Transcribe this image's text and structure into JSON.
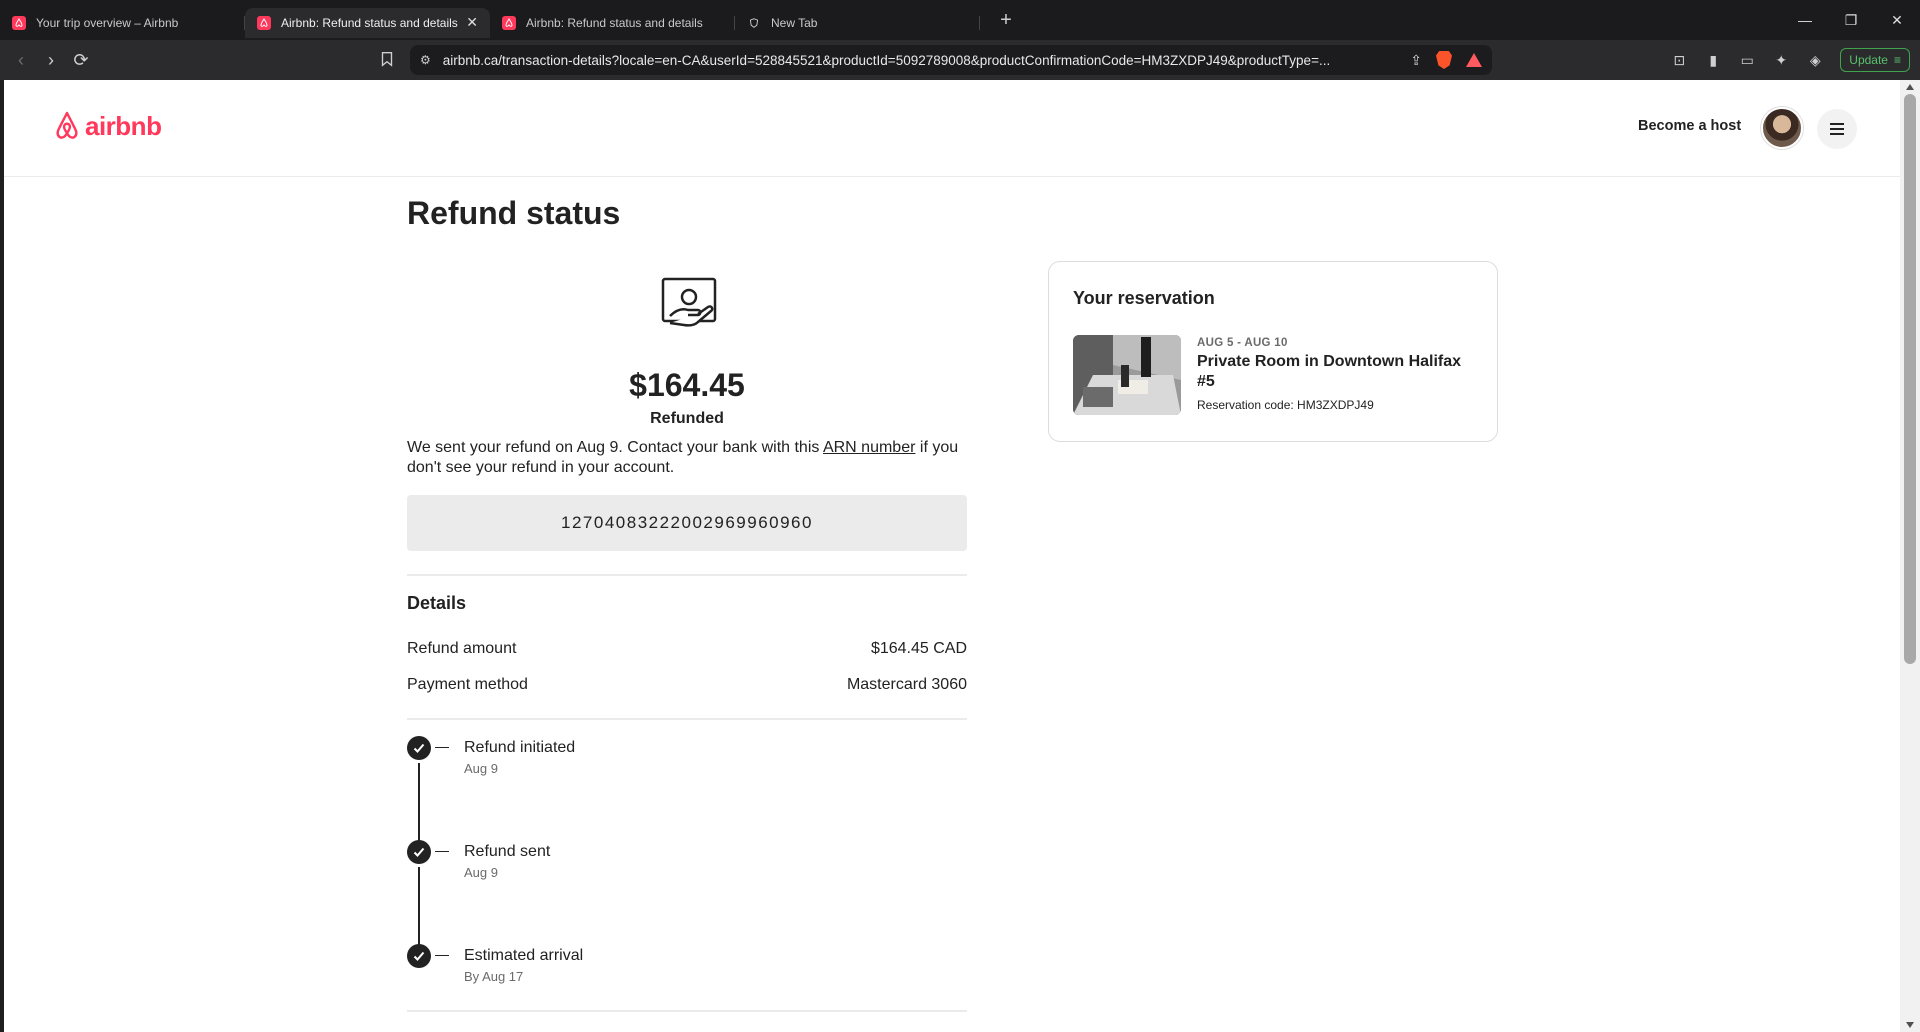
{
  "browser": {
    "tabs": [
      {
        "label": "Your trip overview – Airbnb",
        "active": false
      },
      {
        "label": "Airbnb: Refund status and details",
        "active": true
      },
      {
        "label": "Airbnb: Refund status and details",
        "active": false
      },
      {
        "label": "New Tab",
        "active": false
      }
    ],
    "url": "airbnb.ca/transaction-details?locale=en-CA&userId=528845521&productId=5092789008&productConfirmationCode=HM3ZXDPJ49&productType=...",
    "update_label": "Update",
    "brave_badge": "1"
  },
  "header": {
    "logo_text": "airbnb",
    "become_host": "Become a host"
  },
  "main": {
    "title": "Refund status",
    "amount": "$164.45",
    "amount_status": "Refunded",
    "message_prefix": "We sent your refund on Aug 9. Contact your bank with this",
    "message_link": "ARN number",
    "message_suffix": "if you don't see your refund in your account.",
    "arn": "127040832220029699609​60"
  },
  "details": {
    "title": "Details",
    "rows": [
      {
        "label": "Refund amount",
        "value": "$164.45 CAD"
      },
      {
        "label": "Payment method",
        "value": "Mastercard 3060"
      }
    ]
  },
  "timeline": [
    {
      "label": "Refund initiated",
      "date": "Aug 9"
    },
    {
      "label": "Refund sent",
      "date": "Aug 9"
    },
    {
      "label": "Estimated arrival",
      "date": "By Aug 17"
    }
  ],
  "reservation": {
    "title": "Your reservation",
    "dates": "AUG 5 - AUG 10",
    "name": "Private Room in Downtown Halifax #5",
    "code": "Reservation code: HM3ZXDPJ49"
  },
  "colors": {
    "brand": "#ff385c",
    "text": "#222222",
    "muted": "#6a6a6a"
  }
}
